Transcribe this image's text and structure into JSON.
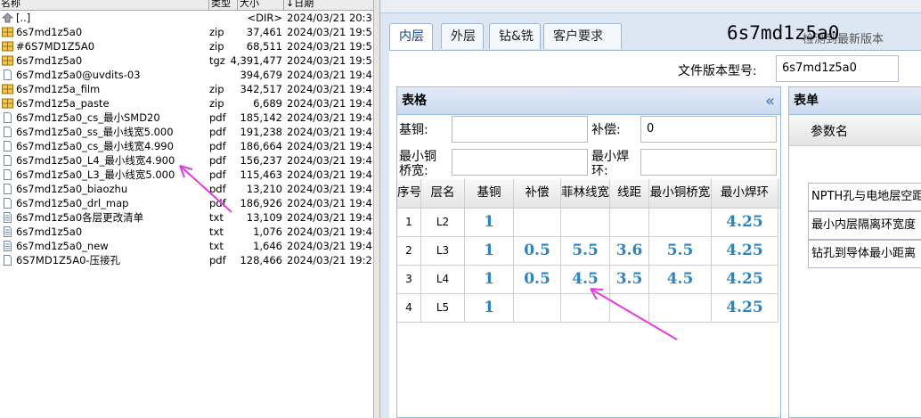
{
  "file_list": {
    "columns": {
      "name": "名称",
      "type": "类型",
      "size": "大小",
      "date": "↓日期"
    },
    "rows": [
      {
        "icon": "up-folder-icon",
        "name": "[..]",
        "type": "",
        "size": "<DIR>",
        "date": "2024/03/21 20:3"
      },
      {
        "icon": "archive-icon",
        "name": "6s7md1z5a0",
        "type": "zip",
        "size": "37,461",
        "date": "2024/03/21 19:5"
      },
      {
        "icon": "archive-icon",
        "name": "#6S7MD1Z5A0",
        "type": "zip",
        "size": "68,511",
        "date": "2024/03/21 19:5"
      },
      {
        "icon": "archive-icon",
        "name": "6s7md1z5a0",
        "type": "tgz",
        "size": "4,391,477",
        "date": "2024/03/21 19:5"
      },
      {
        "icon": "file-icon",
        "name": "6s7md1z5a0@uvdits-03",
        "type": "",
        "size": "394,679",
        "date": "2024/03/21 19:4"
      },
      {
        "icon": "archive-icon",
        "name": "6s7md1z5a_film",
        "type": "zip",
        "size": "342,517",
        "date": "2024/03/21 19:4"
      },
      {
        "icon": "archive-icon",
        "name": "6s7md1z5a_paste",
        "type": "zip",
        "size": "6,689",
        "date": "2024/03/21 19:4"
      },
      {
        "icon": "file-icon",
        "name": "6s7md1z5a0_cs_最小SMD20",
        "type": "pdf",
        "size": "185,142",
        "date": "2024/03/21 19:4"
      },
      {
        "icon": "file-icon",
        "name": "6s7md1z5a0_ss_最小线宽5.000",
        "type": "pdf",
        "size": "191,238",
        "date": "2024/03/21 19:4"
      },
      {
        "icon": "file-icon",
        "name": "6s7md1z5a0_cs_最小线宽4.990",
        "type": "pdf",
        "size": "186,664",
        "date": "2024/03/21 19:4"
      },
      {
        "icon": "file-icon",
        "name": "6s7md1z5a0_L4_最小线宽4.900",
        "type": "pdf",
        "size": "156,237",
        "date": "2024/03/21 19:4"
      },
      {
        "icon": "file-icon",
        "name": "6s7md1z5a0_L3_最小线宽5.000",
        "type": "pdf",
        "size": "115,463",
        "date": "2024/03/21 19:4"
      },
      {
        "icon": "file-icon",
        "name": "6s7md1z5a0_biaozhu",
        "type": "pdf",
        "size": "13,210",
        "date": "2024/03/21 19:4"
      },
      {
        "icon": "file-icon",
        "name": "6s7md1z5a0_drl_map",
        "type": "pdf",
        "size": "186,926",
        "date": "2024/03/21 19:4"
      },
      {
        "icon": "text-file-icon",
        "name": "6s7md1z5a0各层更改清单",
        "type": "txt",
        "size": "13,109",
        "date": "2024/03/21 19:4"
      },
      {
        "icon": "text-file-icon",
        "name": "6s7md1z5a0",
        "type": "txt",
        "size": "1,076",
        "date": "2024/03/21 19:4"
      },
      {
        "icon": "text-file-icon",
        "name": "6s7md1z5a0_new",
        "type": "txt",
        "size": "1,646",
        "date": "2024/03/21 19:4"
      },
      {
        "icon": "file-icon",
        "name": "6S7MD1Z5A0-压接孔",
        "type": "pdf",
        "size": "128,466",
        "date": "2024/03/21 19:2"
      }
    ]
  },
  "app": {
    "tabs": [
      {
        "label": "内层",
        "active": true
      },
      {
        "label": "外层",
        "active": false
      },
      {
        "label": "钻&铣",
        "active": false
      },
      {
        "label": "客户要求",
        "active": false
      }
    ],
    "title": "6s7md1z5a0",
    "update_link": "检测到最新版本",
    "version_label": "文件版本型号:",
    "version_value": "6s7md1z5a0",
    "table_panel": {
      "title": "表格",
      "collapse_icon": "«",
      "fields": {
        "base_copper_label": "基铜:",
        "base_copper_value": "",
        "compensation_label": "补偿:",
        "compensation_value": "0",
        "min_copper_bridge_label_1": "最小铜",
        "min_copper_bridge_label_2": "桥宽:",
        "min_copper_bridge_value": "",
        "min_ring_label_1": "最小焊",
        "min_ring_label_2": "环:",
        "min_ring_value": ""
      },
      "grid": {
        "headers": [
          "序号",
          "层名",
          "基铜",
          "补偿",
          "菲林线宽",
          "线距",
          "最小铜桥宽",
          "最小焊环"
        ],
        "rows": [
          [
            "1",
            "L2",
            "1",
            "",
            "",
            "",
            "",
            "4.25"
          ],
          [
            "2",
            "L3",
            "1",
            "0.5",
            "5.5",
            "3.6",
            "5.5",
            "4.25"
          ],
          [
            "3",
            "L4",
            "1",
            "0.5",
            "4.5",
            "3.5",
            "4.5",
            "4.25"
          ],
          [
            "4",
            "L5",
            "1",
            "",
            "",
            "",
            "",
            "4.25"
          ]
        ]
      }
    },
    "form_panel": {
      "title": "表单",
      "column_header": "参数名",
      "rows": [
        "NPTH孔与电地层空距",
        "最小内层隔离环宽度",
        "钻孔到导体最小距离"
      ]
    }
  },
  "colors": {
    "accent": "#15428b",
    "value_text": "#2e83c4",
    "annotation_arrow": "#e63cdf",
    "panel_border": "#99bbe8"
  }
}
